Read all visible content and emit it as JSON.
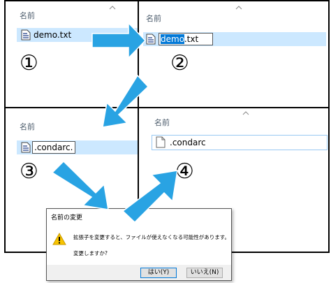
{
  "column_header": "名前",
  "step_labels": [
    "①",
    "②",
    "③",
    "④"
  ],
  "panel1": {
    "file_name": "demo.txt"
  },
  "panel2": {
    "rename_selected": "demo",
    "rename_rest": ".txt"
  },
  "panel3": {
    "rename_text": ".condarc."
  },
  "panel4": {
    "file_name": ".condarc"
  },
  "dialog": {
    "title": "名前の変更",
    "message": "拡張子を変更すると、ファイルが使えなくなる可能性があります。",
    "question": "変更しますか?",
    "yes_label": "はい(Y)",
    "no_label": "いいえ(N)",
    "icon": "warning-icon"
  },
  "colors": {
    "arrow": "#29a3e3",
    "selection": "#cce8ff",
    "text_highlight": "#0078d7",
    "warning": "#f8c400"
  }
}
